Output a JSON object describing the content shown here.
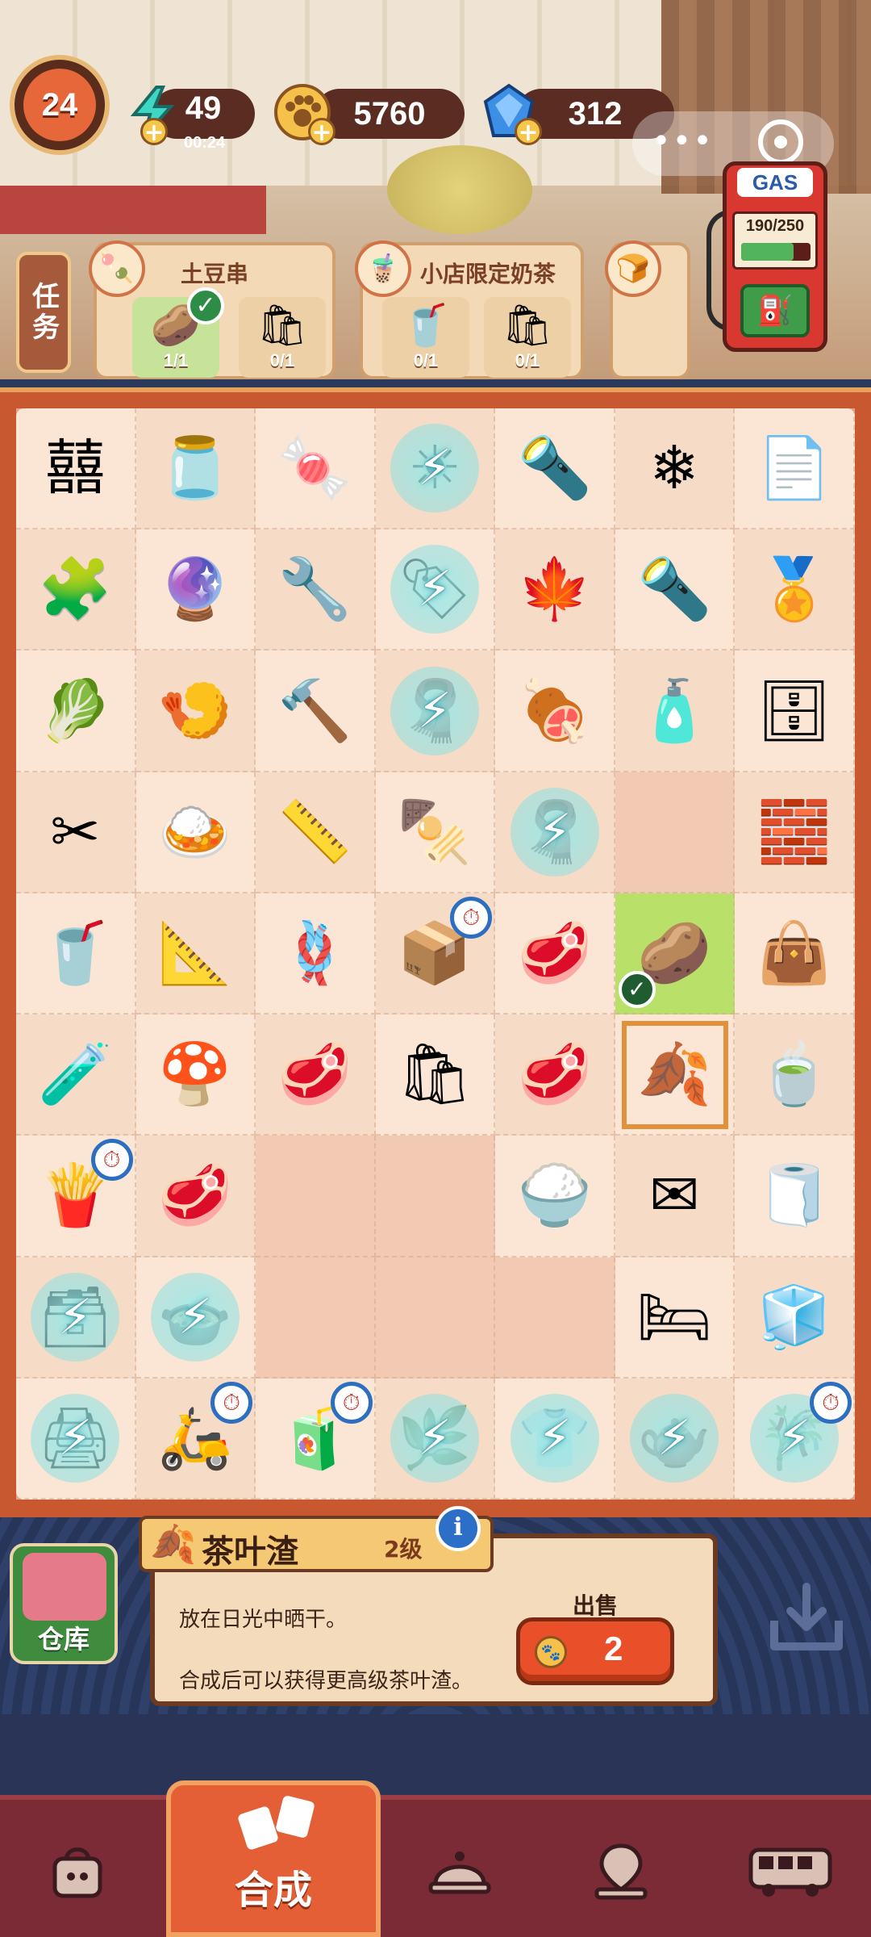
{
  "hud": {
    "level": "24",
    "energy": "49",
    "energy_timer": "00:24",
    "coins": "5760",
    "gems": "312"
  },
  "tasks": {
    "tab_label": "任务",
    "cards": [
      {
        "title": "土豆串",
        "slots": [
          {
            "icon": "potato-cake-icon",
            "count": "1/1",
            "done": true
          },
          {
            "icon": "paper-bag-icon",
            "count": "0/1",
            "done": false
          }
        ]
      },
      {
        "title": "小店限定奶茶",
        "slots": [
          {
            "icon": "milk-tea-icon",
            "count": "0/1",
            "done": false
          },
          {
            "icon": "paper-bag-icon",
            "count": "0/1",
            "done": false
          }
        ]
      }
    ]
  },
  "gas": {
    "label": "GAS",
    "reading": "190/250",
    "fuel_fraction": 0.76
  },
  "board": {
    "columns": 7,
    "rows": 9,
    "cells": [
      {
        "icon": "double-happiness-icon",
        "glyph": "囍"
      },
      {
        "icon": "ink-bottle-icon",
        "glyph": "🫙"
      },
      {
        "icon": "candy-bag-icon",
        "glyph": "🍬"
      },
      {
        "icon": "sun-icon",
        "glyph": "☀",
        "locked": true
      },
      {
        "icon": "flashlight-icon",
        "glyph": "🔦"
      },
      {
        "icon": "snowflake-icon",
        "glyph": "❄"
      },
      {
        "icon": "paper-stack-icon",
        "glyph": "📄"
      },
      {
        "icon": "puzzle-icon",
        "glyph": "🧩"
      },
      {
        "icon": "ornament-icon",
        "glyph": "🔮"
      },
      {
        "icon": "pliers-icon",
        "glyph": "🔧"
      },
      {
        "icon": "tag-icon",
        "glyph": "🏷",
        "locked": true
      },
      {
        "icon": "maple-wreath-icon",
        "glyph": "🍁"
      },
      {
        "icon": "flashlight-icon",
        "glyph": "🔦"
      },
      {
        "icon": "medal-icon",
        "glyph": "🏅"
      },
      {
        "icon": "herbs-board-icon",
        "glyph": "🥬"
      },
      {
        "icon": "shrimp-bowl-icon",
        "glyph": "🍤"
      },
      {
        "icon": "mallet-icon",
        "glyph": "🔨"
      },
      {
        "icon": "cloth-icon",
        "glyph": "🧣",
        "locked": true
      },
      {
        "icon": "meatball-icon",
        "glyph": "🍖"
      },
      {
        "icon": "sauce-bottle-icon",
        "glyph": "🧴"
      },
      {
        "icon": "shelf-icon",
        "glyph": "🗄"
      },
      {
        "icon": "scissors-icon",
        "glyph": "✂"
      },
      {
        "icon": "rice-plate-icon",
        "glyph": "🍛"
      },
      {
        "icon": "tape-measure-icon",
        "glyph": "📏"
      },
      {
        "icon": "skewers-icon",
        "glyph": "🍢"
      },
      {
        "icon": "cloth-icon",
        "glyph": "🧣",
        "locked": true
      },
      {
        "icon": "",
        "glyph": "",
        "empty": true
      },
      {
        "icon": "silver-bars-icon",
        "glyph": "🧱"
      },
      {
        "icon": "cup-icon",
        "glyph": "🥤"
      },
      {
        "icon": "ruler-icon",
        "glyph": "📐"
      },
      {
        "icon": "rope-icon",
        "glyph": "🪢"
      },
      {
        "icon": "snack-box-icon",
        "glyph": "📦",
        "timer": true
      },
      {
        "icon": "meat-icon",
        "glyph": "🥩"
      },
      {
        "icon": "potato-cake-icon",
        "glyph": "🥔",
        "lit": true,
        "ok": true
      },
      {
        "icon": "blue-bag-icon",
        "glyph": "👜"
      },
      {
        "icon": "glue-bottle-icon",
        "glyph": "🧪"
      },
      {
        "icon": "mushroom-icon",
        "glyph": "🍄"
      },
      {
        "icon": "meat-icon",
        "glyph": "🥩"
      },
      {
        "icon": "paper-bag-icon",
        "glyph": "🛍"
      },
      {
        "icon": "meat-icon",
        "glyph": "🥩"
      },
      {
        "icon": "tea-leaf-sack-icon",
        "glyph": "🍂",
        "sel": true
      },
      {
        "icon": "tea-leaves-plate-icon",
        "glyph": "🍵"
      },
      {
        "icon": "snack-box-icon",
        "glyph": "🍟",
        "timer": true
      },
      {
        "icon": "meat-icon",
        "glyph": "🥩"
      },
      {
        "icon": "",
        "glyph": "",
        "empty": true
      },
      {
        "icon": "",
        "glyph": "",
        "empty": true
      },
      {
        "icon": "rice-tray-icon",
        "glyph": "🍚"
      },
      {
        "icon": "envelope-icon",
        "glyph": "✉"
      },
      {
        "icon": "napkin-icon",
        "glyph": "🧻"
      },
      {
        "icon": "cabinet-icon",
        "glyph": "🗃",
        "locked": true
      },
      {
        "icon": "skewer-pot-icon",
        "glyph": "🍲",
        "locked": true
      },
      {
        "icon": "",
        "glyph": "",
        "empty": true
      },
      {
        "icon": "",
        "glyph": "",
        "empty": true
      },
      {
        "icon": "",
        "glyph": "",
        "empty": true
      },
      {
        "icon": "pillow-icon",
        "glyph": "🛏"
      },
      {
        "icon": "sugar-cubes-icon",
        "glyph": "🧊"
      },
      {
        "icon": "printer-icon",
        "glyph": "🖨",
        "locked": true
      },
      {
        "icon": "scooter-icon",
        "glyph": "🛵",
        "timer": true
      },
      {
        "icon": "drinks-rack-icon",
        "glyph": "🧃",
        "timer": true
      },
      {
        "icon": "plant-icon",
        "glyph": "🌿",
        "locked": true
      },
      {
        "icon": "shirt-icon",
        "glyph": "👕",
        "locked": true
      },
      {
        "icon": "kettle-icon",
        "glyph": "🫖",
        "locked": true
      },
      {
        "icon": "bamboo-icon",
        "glyph": "🎋",
        "locked": true,
        "timer": true
      }
    ]
  },
  "selected": {
    "name": "茶叶渣",
    "level": "2级",
    "desc1": "放在日光中晒干。",
    "desc2": "合成后可以获得更高级茶叶渣。",
    "sell_label": "出售",
    "sell_price": "2"
  },
  "warehouse_label": "仓库",
  "nav": {
    "active_label": "合成"
  }
}
